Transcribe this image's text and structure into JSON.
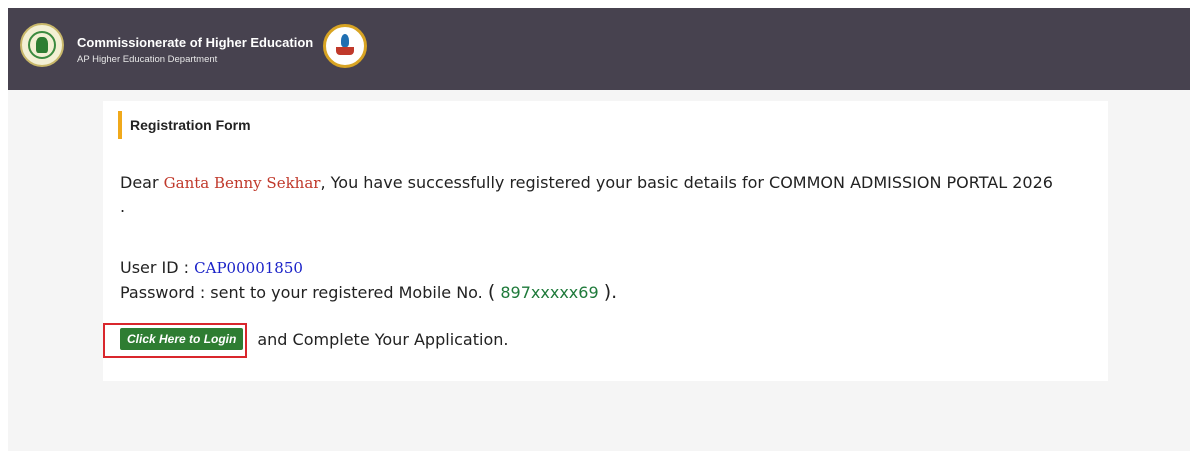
{
  "header": {
    "title": "Commissionerate of Higher Education",
    "subtitle": "AP Higher Education Department",
    "left_logo_icon": "ap-state-emblem-icon",
    "right_logo_icon": "education-seal-icon"
  },
  "form": {
    "section_title": "Registration Form",
    "greeting_prefix": "Dear",
    "applicant_name": "Ganta Benny Sekhar",
    "message": ", You have successfully registered your basic details for COMMON ADMISSION PORTAL 2026 .",
    "user_id_label": "User ID : ",
    "user_id": "CAP00001850",
    "password_label": "Password : sent to your registered Mobile No.",
    "mobile_open": "(",
    "mobile_masked": "897xxxxx69",
    "mobile_close": ").",
    "login_button_label": "Click Here to Login",
    "login_suffix": "and Complete Your Application."
  },
  "colors": {
    "header_bg": "#47424f",
    "accent_bar": "#f0a91b",
    "name_color": "#c0392b",
    "user_id_color": "#1a22c8",
    "mobile_color": "#1e7a3a",
    "button_bg": "#2e7d32",
    "highlight_border": "#d9262c"
  }
}
